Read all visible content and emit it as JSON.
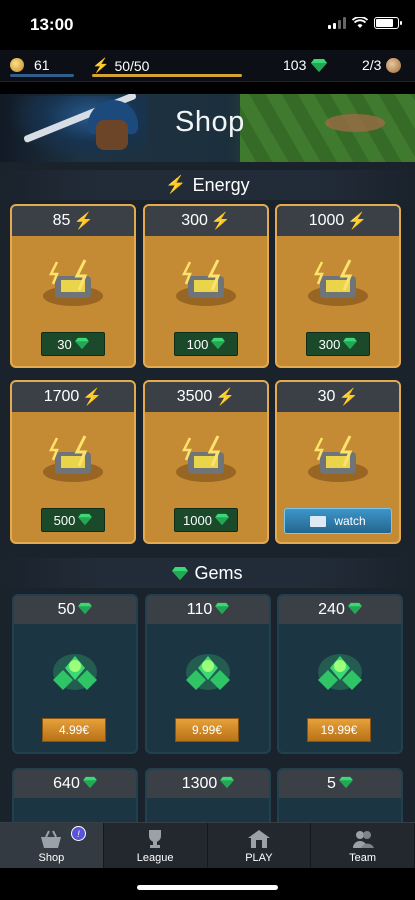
{
  "status_bar": {
    "time": "13:00"
  },
  "resources": {
    "level": "61",
    "energy": "50/50",
    "gems": "103",
    "balls": "2/3"
  },
  "banner": {
    "title": "Shop"
  },
  "sections": {
    "energy": {
      "title": "Energy"
    },
    "gems": {
      "title": "Gems"
    }
  },
  "energy_offers": [
    {
      "amount": "85",
      "price": "30",
      "action": "gems"
    },
    {
      "amount": "300",
      "price": "100",
      "action": "gems"
    },
    {
      "amount": "1000",
      "price": "300",
      "action": "gems"
    },
    {
      "amount": "1700",
      "price": "500",
      "action": "gems"
    },
    {
      "amount": "3500",
      "price": "1000",
      "action": "gems"
    },
    {
      "amount": "30",
      "price": "watch",
      "action": "watch-ad"
    }
  ],
  "gem_offers": [
    {
      "amount": "50",
      "price": "4.99€"
    },
    {
      "amount": "110",
      "price": "9.99€"
    },
    {
      "amount": "240",
      "price": "19.99€"
    },
    {
      "amount": "640",
      "price": ""
    },
    {
      "amount": "1300",
      "price": ""
    },
    {
      "amount": "5",
      "price": ""
    }
  ],
  "tabs": [
    {
      "label": "Shop",
      "icon": "shop-basket-icon",
      "active": true,
      "badge": "!"
    },
    {
      "label": "League",
      "icon": "trophy-icon",
      "active": false
    },
    {
      "label": "PLAY",
      "icon": "home-icon",
      "active": false
    },
    {
      "label": "Team",
      "icon": "team-icon",
      "active": false
    }
  ],
  "colors": {
    "energy_card": "#c58a34",
    "gem_card": "#1b3543",
    "gem_green": "#3bd873",
    "energy_yellow": "#f8c534",
    "watch_blue": "#2f7fb0",
    "price_orange": "#e6a13a"
  }
}
